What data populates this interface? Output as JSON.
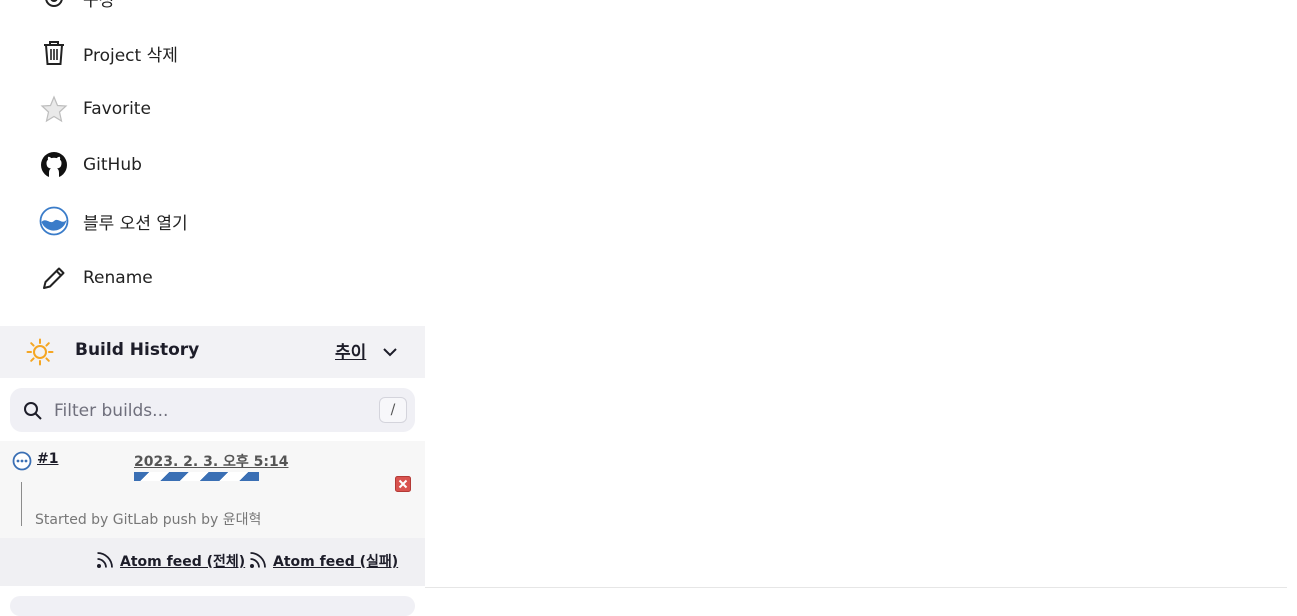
{
  "sidebar": {
    "items": [
      {
        "label": "구성",
        "icon": "gear-icon"
      },
      {
        "label": "Project 삭제",
        "icon": "trash-icon"
      },
      {
        "label": "Favorite",
        "icon": "star-icon"
      },
      {
        "label": "GitHub",
        "icon": "github-icon"
      },
      {
        "label": "블루 오션 열기",
        "icon": "blue-ocean-icon"
      },
      {
        "label": "Rename",
        "icon": "pencil-icon"
      }
    ]
  },
  "build_history": {
    "title": "Build History",
    "trend_label": "추이",
    "filter_placeholder": "Filter builds...",
    "shortcut_key": "/",
    "builds": [
      {
        "number": "#1",
        "date": "2023. 2. 3. 오후 5:14",
        "cause": "Started by GitLab push by 윤대혁",
        "status": "in-progress"
      }
    ],
    "feeds": {
      "all": "Atom feed (전체)",
      "failed": "Atom feed (실패)"
    }
  },
  "colors": {
    "accent_blue": "#3a6fb4",
    "sun_orange": "#f5a623",
    "cancel_red": "#d9534f",
    "header_bg": "#f2f2f5"
  }
}
